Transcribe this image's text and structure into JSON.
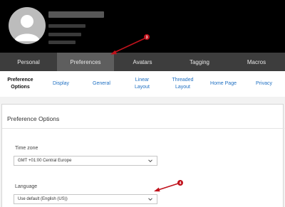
{
  "tabs": [
    {
      "label": "Personal"
    },
    {
      "label": "Preferences"
    },
    {
      "label": "Avatars"
    },
    {
      "label": "Tagging"
    },
    {
      "label": "Macros"
    }
  ],
  "subtabs": [
    {
      "label": "Preference\nOptions"
    },
    {
      "label": "Display"
    },
    {
      "label": "General"
    },
    {
      "label": "Linear\nLayout"
    },
    {
      "label": "Threaded\nLayout"
    },
    {
      "label": "Home Page"
    },
    {
      "label": "Privacy"
    }
  ],
  "panel": {
    "title": "Preference Options",
    "timezone": {
      "label": "Time zone",
      "value": "GMT +01:00 Central Europe"
    },
    "language": {
      "label": "Language",
      "value": "Use default (English (US))"
    }
  },
  "annotations": [
    {
      "number": "3",
      "color": "#c0121c"
    },
    {
      "number": "4",
      "color": "#c0121c"
    }
  ],
  "icons": {
    "avatar": "person-silhouette-icon",
    "dropdown": "chevron-down-icon"
  }
}
